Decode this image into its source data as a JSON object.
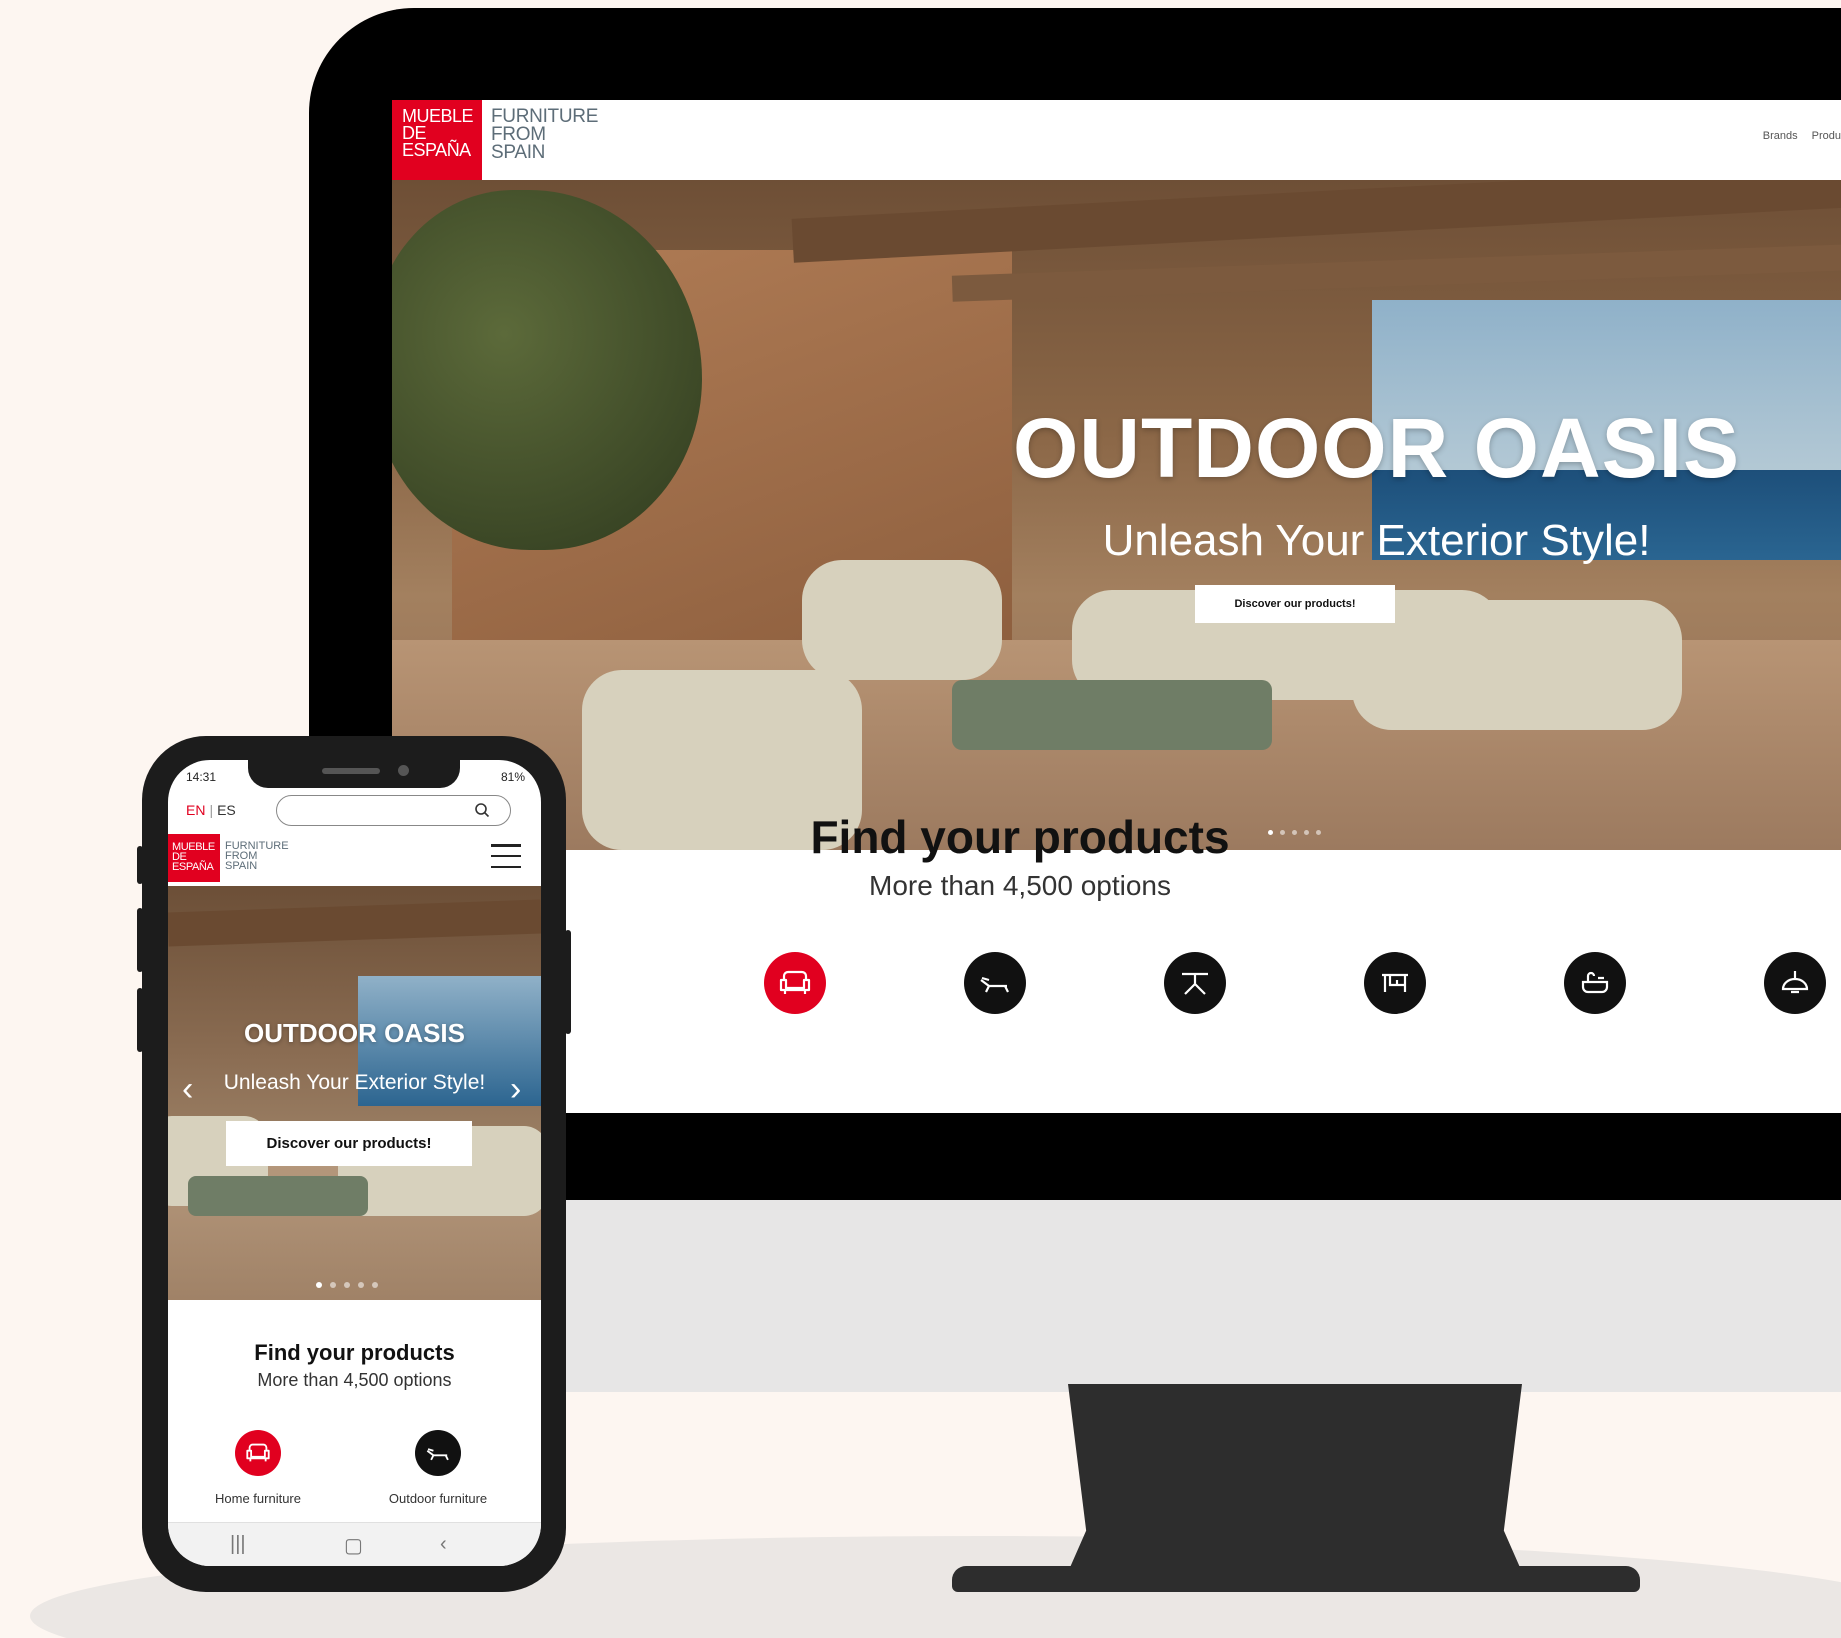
{
  "desktop": {
    "logo": {
      "red_text": "MUEBLE\nDE\nESPAÑA",
      "grey_text": "FURNITURE\nFROM\nSPAIN"
    },
    "nav": [
      "Brands",
      "Produ"
    ],
    "hero": {
      "title": "OUTDOOR OASIS",
      "subtitle": "Unleash Your Exterior Style!",
      "button": "Discover our products!",
      "slides": 5,
      "active_slide": 1
    },
    "find": {
      "title": "Find your products",
      "subtitle": "More than 4,500 options"
    },
    "categories": [
      {
        "icon": "armchair-icon",
        "active": true,
        "color": "#e1001f"
      },
      {
        "icon": "sunbed-icon",
        "active": false,
        "color": "#111111"
      },
      {
        "icon": "table-icon",
        "active": false,
        "color": "#111111"
      },
      {
        "icon": "desk-icon",
        "active": false,
        "color": "#111111"
      },
      {
        "icon": "bathroom-icon",
        "active": false,
        "color": "#111111"
      },
      {
        "icon": "lamp-icon",
        "active": false,
        "color": "#111111"
      }
    ]
  },
  "phone": {
    "status": {
      "time": "14:31",
      "battery": "81%"
    },
    "languages": {
      "active": "EN",
      "other": "ES"
    },
    "search": {
      "placeholder": "",
      "icon": "search-icon"
    },
    "logo": {
      "red_text": "MUEBLE\nDE\nESPAÑA",
      "grey_text": "FURNITURE\nFROM\nSPAIN"
    },
    "hero": {
      "title": "OUTDOOR OASIS",
      "subtitle": "Unleash Your Exterior Style!",
      "button": "Discover our products!",
      "slides": 5,
      "active_slide": 1
    },
    "find": {
      "title": "Find your products",
      "subtitle": "More than 4,500 options"
    },
    "categories": [
      {
        "label": "Home furniture",
        "icon": "armchair-icon",
        "color": "#e1001f"
      },
      {
        "label": "Outdoor furniture",
        "icon": "sunbed-icon",
        "color": "#111111"
      }
    ],
    "system_nav": [
      "recent-apps-icon",
      "home-icon",
      "back-icon"
    ]
  },
  "colors": {
    "brand_red": "#e1001f",
    "brand_grey": "#5d6d78",
    "background": "#fdf6f1"
  }
}
